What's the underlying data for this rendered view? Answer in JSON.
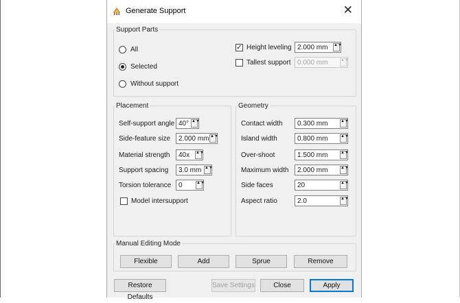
{
  "dialog": {
    "title": "Generate Support",
    "app_icon": "support-generator-icon",
    "close_icon": "close-icon"
  },
  "support_parts": {
    "legend": "Support Parts",
    "options": [
      {
        "label": "All",
        "selected": false
      },
      {
        "label": "Selected",
        "selected": true
      },
      {
        "label": "Without support",
        "selected": false
      }
    ],
    "height_leveling": {
      "label": "Height leveling",
      "checked": true,
      "value": "2.000 mm"
    },
    "tallest_support": {
      "label": "Tallest support",
      "checked": false,
      "value": "0.000 mm",
      "enabled": false
    }
  },
  "placement": {
    "legend": "Placement",
    "fields": [
      {
        "label": "Self-support angle",
        "value": "40°"
      },
      {
        "label": "Side-feature size",
        "value": "2.000 mm"
      },
      {
        "label": "Material strength",
        "value": "40x"
      },
      {
        "label": "Support spacing",
        "value": "3.0 mm"
      },
      {
        "label": "Torsion tolerance",
        "value": "0"
      }
    ],
    "model_intersupport": {
      "label": "Model intersupport",
      "checked": false
    }
  },
  "geometry": {
    "legend": "Geometry",
    "fields": [
      {
        "label": "Contact width",
        "value": "0.300 mm"
      },
      {
        "label": "Island width",
        "value": "0.800 mm"
      },
      {
        "label": "Over-shoot",
        "value": "1.500 mm"
      },
      {
        "label": "Maximum width",
        "value": "2.000 mm"
      },
      {
        "label": "Side faces",
        "value": "20"
      },
      {
        "label": "Aspect ratio",
        "value": "2.0"
      }
    ]
  },
  "manual_editing": {
    "legend": "Manual Editing Mode",
    "buttons": [
      "Flexible",
      "Add",
      "Sprue",
      "Remove"
    ]
  },
  "footer": {
    "restore_defaults": "Restore Defaults",
    "save_settings": "Save Settings",
    "close": "Close",
    "apply": "Apply"
  },
  "spin_arrows": "▲▼",
  "check_mark": "✓",
  "close_glyph": "✕"
}
